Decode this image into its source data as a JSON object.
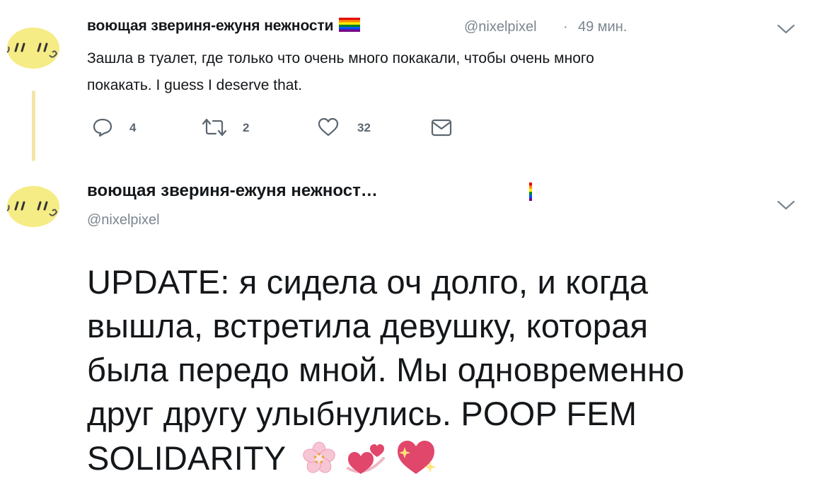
{
  "tweet1": {
    "display_name": "воющая звериня-ежуня нежности",
    "flag_icon": "rainbow-flag-icon",
    "handle": "@nixelpixel",
    "separator": "·",
    "time": "49 мин.",
    "text_line1": "Зашла в туалет, где только что очень много покакали, чтобы очень много",
    "text_line2": "покакать. I guess I deserve that.",
    "actions": {
      "reply_count": "4",
      "retweet_count": "2",
      "like_count": "32"
    }
  },
  "tweet2": {
    "display_name": "воющая звериня-ежуня нежност…",
    "handle": "@nixelpixel",
    "text_lines": [
      "UPDATE: я сидела оч долго, и когда",
      "вышла, встретила девушку, которая",
      "была передо мной. Мы одновременно",
      "друг другу улыбнулись. POOP FEM",
      "SOLIDARITY"
    ],
    "emoji_icons": [
      "cherry-blossom-icon",
      "revolving-hearts-icon",
      "sparkling-heart-icon"
    ]
  },
  "colors": {
    "secondary_text": "#7b8690",
    "action_icon": "#5b6670",
    "avatar_yellow": "#f6ec85",
    "thread_line": "#f3e6a6"
  }
}
